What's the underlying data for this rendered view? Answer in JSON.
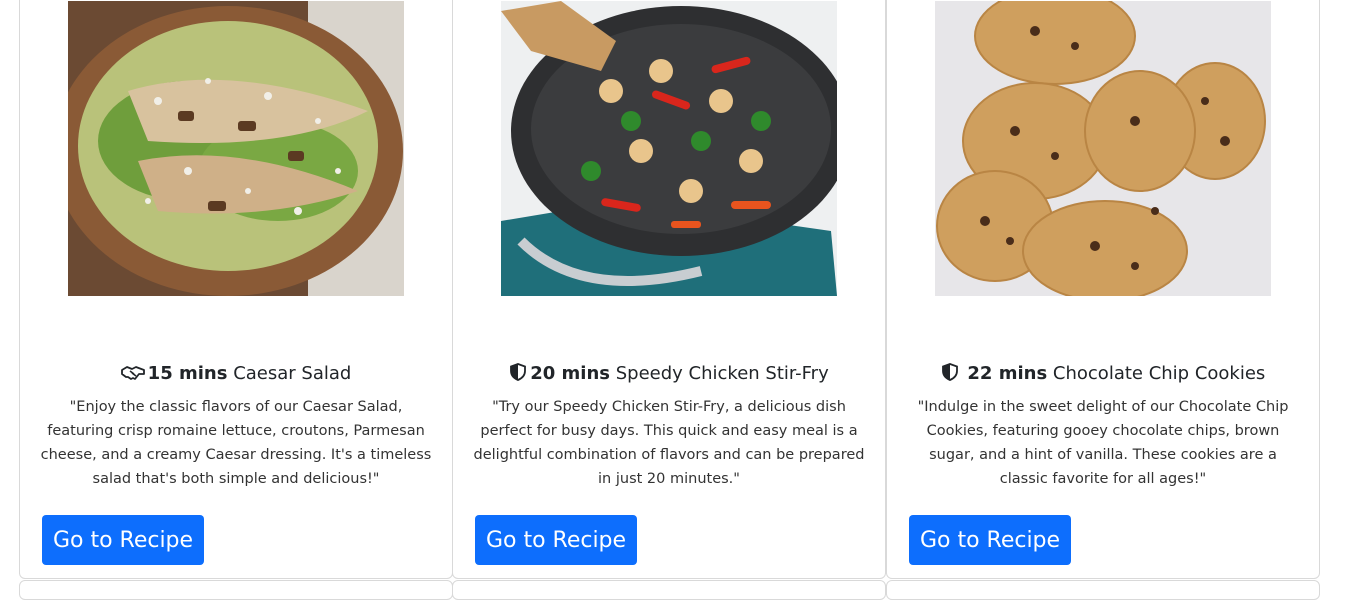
{
  "cards": [
    {
      "time": "15 mins",
      "name": "Caesar Salad",
      "icon": "handshake-icon",
      "description": "\"Enjoy the classic flavors of our Caesar Salad, featuring crisp romaine lettuce, croutons, Parmesan cheese, and a creamy Caesar dressing. It's a timeless salad that's both simple and delicious!\"",
      "button": "Go to Recipe"
    },
    {
      "time": "20 mins",
      "name": "Speedy Chicken Stir-Fry",
      "icon": "shield-half-icon",
      "description": "\"Try our Speedy Chicken Stir-Fry, a delicious dish perfect for busy days. This quick and easy meal is a delightful combination of flavors and can be prepared in just 20 minutes.\"",
      "button": "Go to Recipe"
    },
    {
      "time": "22 mins",
      "name": "Chocolate Chip Cookies",
      "icon": "shield-half-icon",
      "description": "\"Indulge in the sweet delight of our Chocolate Chip Cookies, featuring gooey chocolate chips, brown sugar, and a hint of vanilla. These cookies are a classic favorite for all ages!\"",
      "button": "Go to Recipe"
    }
  ],
  "colors": {
    "accent": "#0d6efd",
    "border": "#d9d9d9"
  }
}
